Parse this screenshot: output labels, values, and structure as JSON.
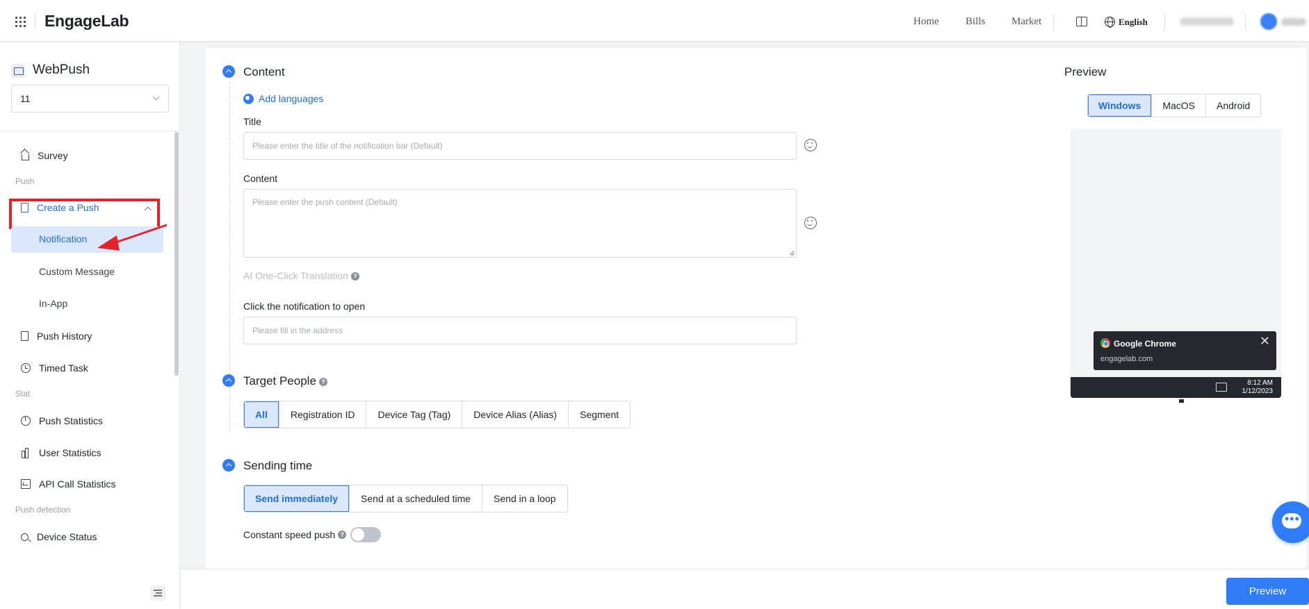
{
  "topbar": {
    "logo": "EngageLab",
    "nav": {
      "home": "Home",
      "bills": "Bills",
      "market": "Market"
    },
    "language": "English"
  },
  "sidebar": {
    "app_title": "WebPush",
    "app_select_value": "11",
    "items": {
      "survey": "Survey",
      "group_push": "Push",
      "create_push": "Create a Push",
      "notification": "Notification",
      "custom_message": "Custom Message",
      "in_app": "In-App",
      "push_history": "Push History",
      "timed_task": "Timed Task",
      "group_stat": "Stat",
      "push_statistics": "Push Statistics",
      "user_statistics": "User Statistics",
      "api_call_statistics": "API Call Statistics",
      "group_detection": "Push detection",
      "device_status": "Device Status"
    }
  },
  "content": {
    "section_title": "Content",
    "add_languages": "Add languages",
    "title_label": "Title",
    "title_placeholder": "Please enter the title of the notification bar (Default)",
    "content_label": "Content",
    "content_placeholder": "Please enter the push content (Default)",
    "ai_translation": "AI One-Click Translation",
    "click_open_label": "Click the notification to open",
    "click_open_placeholder": "Please fill in the address"
  },
  "target": {
    "section_title": "Target People",
    "options": [
      "All",
      "Registration ID",
      "Device Tag (Tag)",
      "Device Alias (Alias)",
      "Segment"
    ],
    "selected": "All"
  },
  "sending": {
    "section_title": "Sending time",
    "options": [
      "Send immediately",
      "Send at a scheduled time",
      "Send in a loop"
    ],
    "selected": "Send immediately",
    "constant_speed_label": "Constant speed push",
    "constant_speed_on": false
  },
  "preview": {
    "title": "Preview",
    "os_tabs": [
      "Windows",
      "MacOS",
      "Android"
    ],
    "selected_os": "Windows",
    "toast_app": "Google Chrome",
    "toast_site": "engagelab.com",
    "time": "8:12 AM",
    "date": "1/12/2023"
  },
  "footer": {
    "preview_button": "Preview"
  },
  "colors": {
    "accent": "#2f7cf6",
    "highlight_red": "#e8202a",
    "selected_bg": "#dbe8fb"
  }
}
